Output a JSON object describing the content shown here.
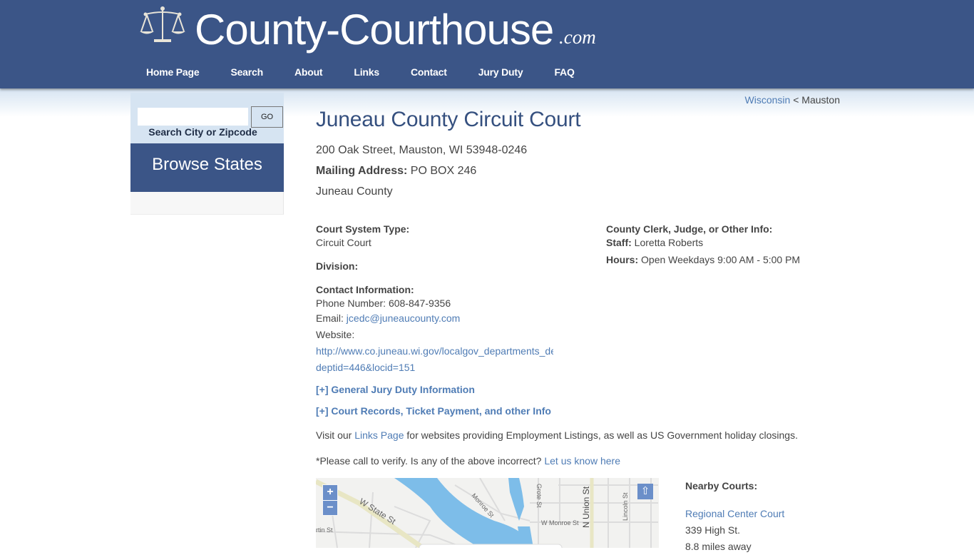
{
  "site": {
    "title": "County-Courthouse",
    "tld": ".com",
    "logo_icon": "scales-of-justice-icon"
  },
  "nav": {
    "items": [
      {
        "label": "Home Page"
      },
      {
        "label": "Search"
      },
      {
        "label": "About"
      },
      {
        "label": "Links"
      },
      {
        "label": "Contact"
      },
      {
        "label": "Jury Duty"
      },
      {
        "label": "FAQ"
      }
    ]
  },
  "sidebar": {
    "search_value": "",
    "search_placeholder": "",
    "go_label": "GO",
    "search_label": "Search City or Zipcode",
    "browse_label": "Browse States"
  },
  "breadcrumb": {
    "state": "Wisconsin",
    "separator": "<",
    "city": "Mauston"
  },
  "court": {
    "title": "Juneau County Circuit Court",
    "address": "200 Oak Street, Mauston, WI 53948-0246",
    "mailing_label": "Mailing Address:",
    "mailing_value": "PO BOX 246",
    "county": "Juneau County",
    "system_type_label": "Court System Type:",
    "system_type_value": "Circuit Court",
    "division_label": "Division:",
    "contact_label": "Contact Information:",
    "phone_text": "Phone Number: 608-847-9356",
    "email_label": "Email:",
    "email_value": "jcedc@juneaucounty.com",
    "website_label": "Website:",
    "website_line1": "http://www.co.juneau.wi.gov/localgov_departments_details.asp?",
    "website_line2": "deptid=446&locid=151",
    "clerk_label": "County Clerk, Judge, or Other Info:",
    "staff_label": "Staff:",
    "staff_value": "Loretta Roberts",
    "hours_label": "Hours:",
    "hours_value": "Open Weekdays 9:00 AM - 5:00 PM"
  },
  "toggles": {
    "jury": "[+] General Jury Duty Information",
    "records": "[+] Court Records, Ticket Payment, and other Info"
  },
  "notes": {
    "visit_prefix": "Visit our",
    "links_page": "Links Page",
    "visit_suffix": "for websites providing Employment Listings, as well as US Government holiday closings.",
    "verify_text": "*Please call to verify. Is any of the above incorrect?",
    "verify_link": "Let us know here"
  },
  "map": {
    "zoom_in": "+",
    "zoom_out": "−",
    "fullscreen": "⇧",
    "street_labels": [
      "W State St",
      "Monroe St",
      "Grote St",
      "N Union St",
      "Lincoln St",
      "W Monroe St",
      "rtin St"
    ]
  },
  "nearby": {
    "title": "Nearby Courts:",
    "courts": [
      {
        "name": "Regional Center Court",
        "address": "339 High St.",
        "distance": "8.8 miles away"
      }
    ]
  }
}
